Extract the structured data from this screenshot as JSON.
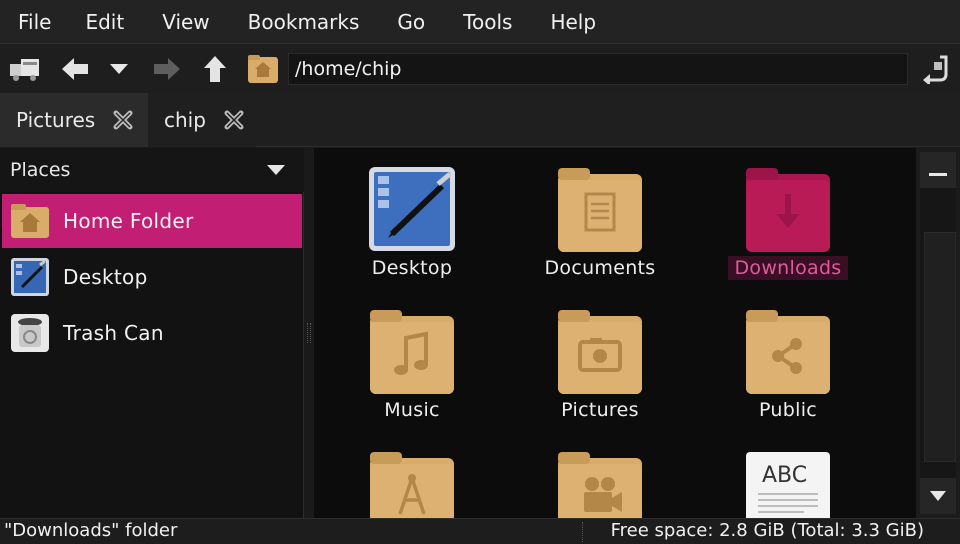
{
  "menubar": {
    "items": [
      "File",
      "Edit",
      "View",
      "Bookmarks",
      "Go",
      "Tools",
      "Help"
    ]
  },
  "toolbar": {
    "location_path": "/home/chip",
    "buttons": [
      "open-terminal-icon",
      "back-arrow-icon",
      "history-dropdown-icon",
      "forward-arrow-icon",
      "up-arrow-icon",
      "home-folder-icon",
      "go-icon"
    ]
  },
  "tabs": [
    {
      "label": "Pictures",
      "active": false
    },
    {
      "label": "chip",
      "active": true
    }
  ],
  "sidebar": {
    "header": "Places",
    "items": [
      {
        "label": "Home Folder",
        "icon": "home-folder-icon",
        "selected": true
      },
      {
        "label": "Desktop",
        "icon": "desktop-icon",
        "selected": false
      },
      {
        "label": "Trash Can",
        "icon": "trash-can-icon",
        "selected": false
      }
    ]
  },
  "files": [
    {
      "label": "Desktop",
      "icon": "desktop-icon",
      "selected": false
    },
    {
      "label": "Documents",
      "icon": "documents-folder-icon",
      "selected": false
    },
    {
      "label": "Downloads",
      "icon": "downloads-folder-icon",
      "selected": true
    },
    {
      "label": "Music",
      "icon": "music-folder-icon",
      "selected": false
    },
    {
      "label": "Pictures",
      "icon": "pictures-folder-icon",
      "selected": false
    },
    {
      "label": "Public",
      "icon": "public-folder-icon",
      "selected": false
    },
    {
      "label": "",
      "icon": "templates-folder-icon",
      "selected": false
    },
    {
      "label": "",
      "icon": "videos-folder-icon",
      "selected": false
    },
    {
      "label": "",
      "icon": "text-file-icon",
      "selected": false
    }
  ],
  "text_file_preview": "ABC",
  "statusbar": {
    "left": "\"Downloads\" folder",
    "right": "Free space: 2.8 GiB (Total: 3.3 GiB)"
  },
  "colors": {
    "accent": "#c21e73",
    "folder": "#d9ac6a",
    "folder_selected": "#b81b55",
    "background": "#0c0c0c"
  }
}
